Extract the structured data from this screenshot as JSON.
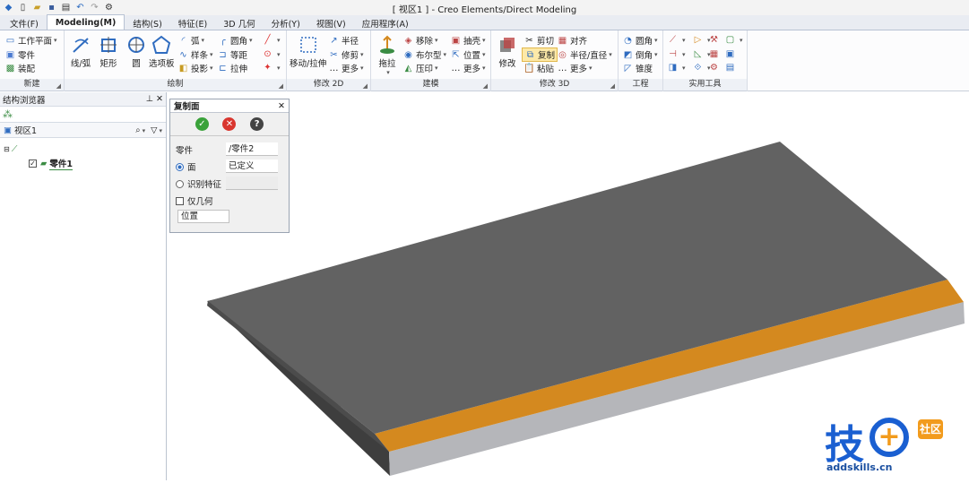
{
  "window": {
    "title": "[ 视区1 ] - Creo Elements/Direct Modeling"
  },
  "tabs": [
    "文件(F)",
    "Modeling(M)",
    "结构(S)",
    "特征(E)",
    "3D 几何",
    "分析(Y)",
    "视图(V)",
    "应用程序(A)"
  ],
  "ribbon": {
    "new": {
      "label": "新建",
      "items": [
        "工作平面",
        "零件",
        "装配"
      ]
    },
    "draw": {
      "label": "绘制",
      "line_arc": "线/弧",
      "rect": "矩形",
      "circle": "圆",
      "template": "选项板",
      "arc": "弧",
      "spline": "样条",
      "project": "投影",
      "fillet": "圆角",
      "offset": "等距",
      "extrude": "拉伸"
    },
    "modify2d": {
      "label": "修改 2D",
      "move": "移动/拉伸",
      "radius": "半径",
      "trim": "修剪",
      "more": "更多"
    },
    "modeling": {
      "label": "建模",
      "pull": "拖拉",
      "remove": "移除",
      "boolean": "布尔型",
      "imprint": "压印",
      "shell": "抽壳",
      "position": "位置",
      "more": "更多"
    },
    "modify3d": {
      "label": "修改 3D",
      "modify": "修改",
      "cut": "剪切",
      "copy": "复制",
      "paste": "粘贴",
      "align": "对齐",
      "radius_dia": "半径/直径",
      "more": "更多"
    },
    "engineering": {
      "label": "工程",
      "fillet": "圆角",
      "chamfer": "倒角",
      "taper": "锥度"
    },
    "utilities": {
      "label": "实用工具"
    }
  },
  "browser": {
    "title": "结构浏览器",
    "viewport": "视区1",
    "part": "零件1"
  },
  "dialog": {
    "title": "复制面",
    "part_label": "零件",
    "part_value": "/零件2",
    "face_label": "面",
    "face_value": "已定义",
    "feature_label": "识别特征",
    "geom_only": "仅几何",
    "position": "位置"
  },
  "watermark": {
    "site": "addskills.cn",
    "logo_text": "技",
    "logo_badge": "社区"
  },
  "colors": {
    "accent": "#2f6cc0",
    "face_top": "#626262",
    "highlight": "#d4891f",
    "side": "#b5b6ba"
  }
}
